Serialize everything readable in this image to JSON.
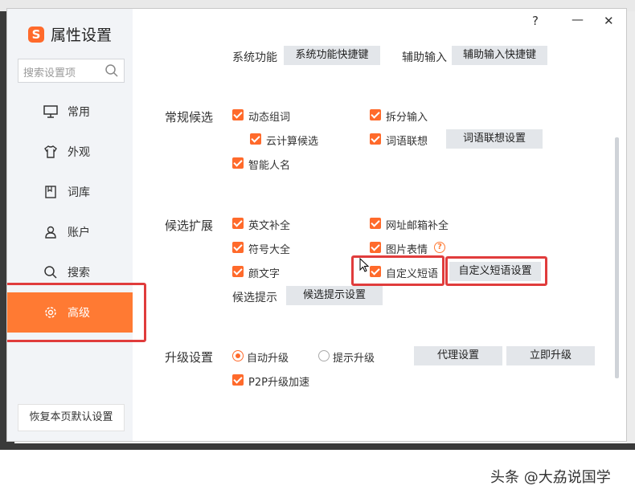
{
  "window": {
    "title": "属性设置",
    "help_icon": "?",
    "min_icon": "—",
    "close_icon": "✕"
  },
  "sidebar": {
    "search_placeholder": "搜索设置项",
    "items": [
      {
        "label": "常用",
        "icon": "monitor-icon"
      },
      {
        "label": "外观",
        "icon": "shirt-icon"
      },
      {
        "label": "词库",
        "icon": "book-icon"
      },
      {
        "label": "账户",
        "icon": "user-icon"
      },
      {
        "label": "搜索",
        "icon": "search-icon"
      },
      {
        "label": "高级",
        "icon": "gear-icon",
        "active": true
      }
    ],
    "reset_label": "恢复本页默认设置"
  },
  "top_row": {
    "sys_label": "系统功能",
    "sys_button": "系统功能快捷键",
    "aux_label": "辅助输入",
    "aux_button": "辅助输入快捷键"
  },
  "normal_candidates": {
    "label": "常规候选",
    "dynamic_phrase": "动态组词",
    "split_input": "拆分输入",
    "cloud_candidates": "云计算候选",
    "word_assoc": "词语联想",
    "word_assoc_button": "词语联想设置",
    "smart_name": "智能人名"
  },
  "candidate_ext": {
    "label": "候选扩展",
    "english_complete": "英文补全",
    "url_email_complete": "网址邮箱补全",
    "symbols": "符号大全",
    "image_emoji": "图片表情",
    "kaomoji": "颜文字",
    "custom_phrase": "自定义短语",
    "custom_phrase_button": "自定义短语设置",
    "hint_label": "候选提示",
    "hint_button": "候选提示设置"
  },
  "upgrade": {
    "label": "升级设置",
    "auto_upgrade": "自动升级",
    "prompt_upgrade": "提示升级",
    "proxy_button": "代理设置",
    "upgrade_now_button": "立即升级",
    "p2p": "P2P升级加速"
  },
  "watermark": "头条 @大劦说国学",
  "colors": {
    "accent": "#ff7a33",
    "highlight": "#e03c3c",
    "sidebar_bg": "#f2f4f7"
  }
}
